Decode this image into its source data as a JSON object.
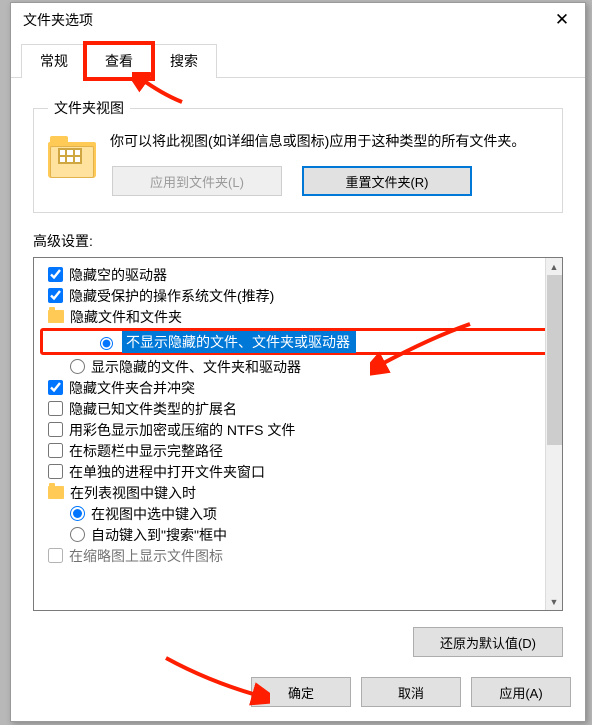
{
  "dialog": {
    "title": "文件夹选项",
    "close_label": "✕"
  },
  "tabs": {
    "general": "常规",
    "view": "查看",
    "search": "搜索"
  },
  "folder_view": {
    "legend": "文件夹视图",
    "description": "你可以将此视图(如详细信息或图标)应用于这种类型的所有文件夹。",
    "apply_btn": "应用到文件夹(L)",
    "reset_btn": "重置文件夹(R)"
  },
  "advanced": {
    "label": "高级设置:",
    "items": {
      "hide_empty_drives": "隐藏空的驱动器",
      "hide_protected_os": "隐藏受保护的操作系统文件(推荐)",
      "hidden_files_group": "隐藏文件和文件夹",
      "dont_show_hidden": "不显示隐藏的文件、文件夹或驱动器",
      "show_hidden": "显示隐藏的文件、文件夹和驱动器",
      "hide_merge_conflict": "隐藏文件夹合并冲突",
      "hide_known_ext": "隐藏已知文件类型的扩展名",
      "ntfs_color": "用彩色显示加密或压缩的 NTFS 文件",
      "full_path_title": "在标题栏中显示完整路径",
      "separate_process": "在单独的进程中打开文件夹窗口",
      "type_in_list_group": "在列表视图中键入时",
      "type_select": "在视图中选中键入项",
      "type_auto_search": "自动键入到\"搜索\"框中",
      "thumb_cut": "在缩略图上显示文件图标"
    },
    "restore_btn": "还原为默认值(D)"
  },
  "footer": {
    "ok": "确定",
    "cancel": "取消",
    "apply": "应用(A)"
  }
}
